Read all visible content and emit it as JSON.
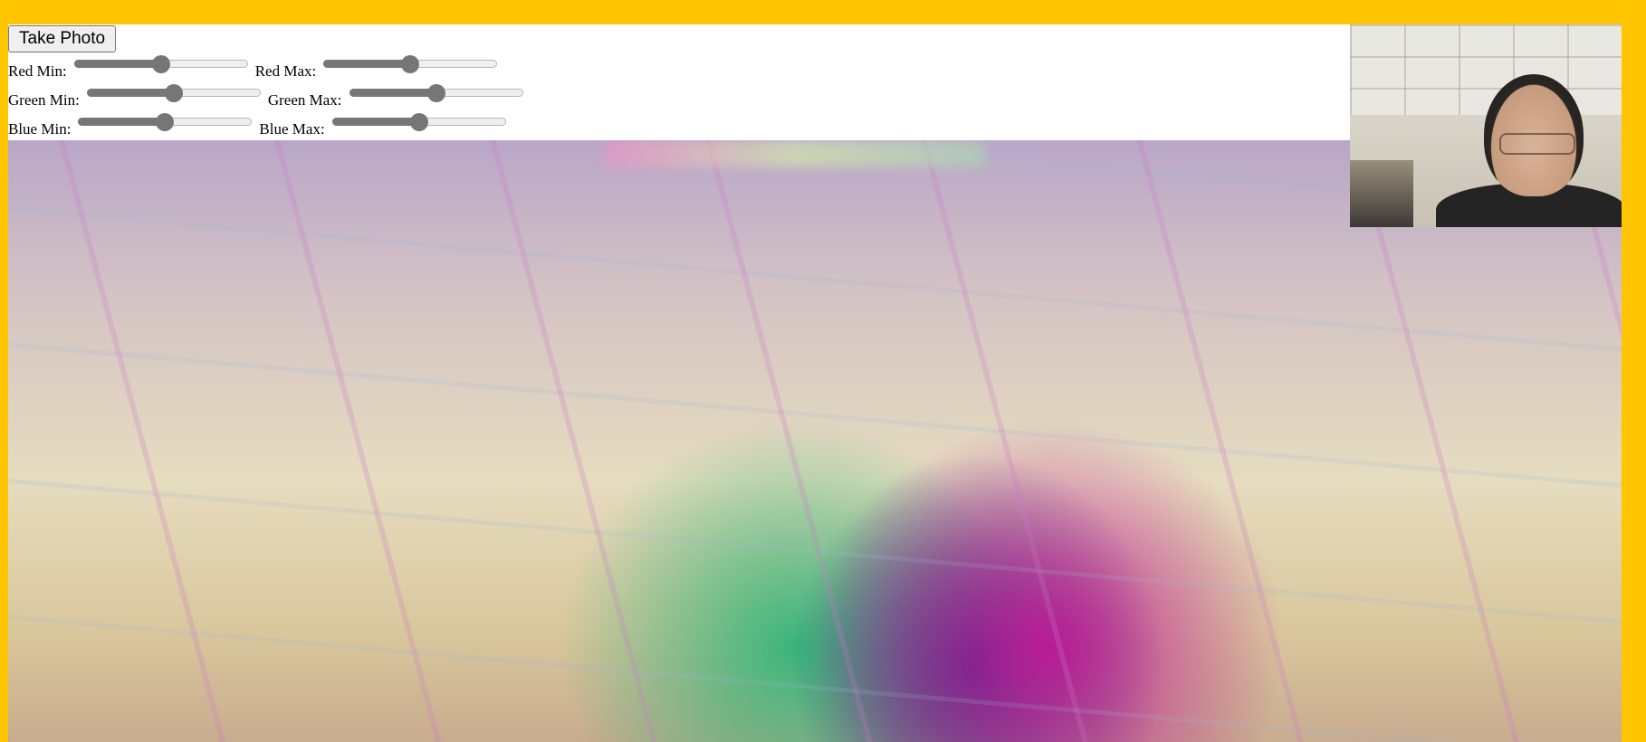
{
  "toolbar": {
    "take_photo_label": "Take Photo"
  },
  "sliders": {
    "red_min": {
      "label": "Red Min:",
      "value": 0.5
    },
    "red_max": {
      "label": "Red Max:",
      "value": 0.5
    },
    "green_min": {
      "label": "Green Min:",
      "value": 0.5
    },
    "green_max": {
      "label": "Green Max:",
      "value": 0.5
    },
    "blue_min": {
      "label": "Blue Min:",
      "value": 0.5
    },
    "blue_max": {
      "label": "Blue Max:",
      "value": 0.5
    }
  },
  "colors": {
    "page_border": "#ffc600",
    "slider_accent": "#767676"
  }
}
